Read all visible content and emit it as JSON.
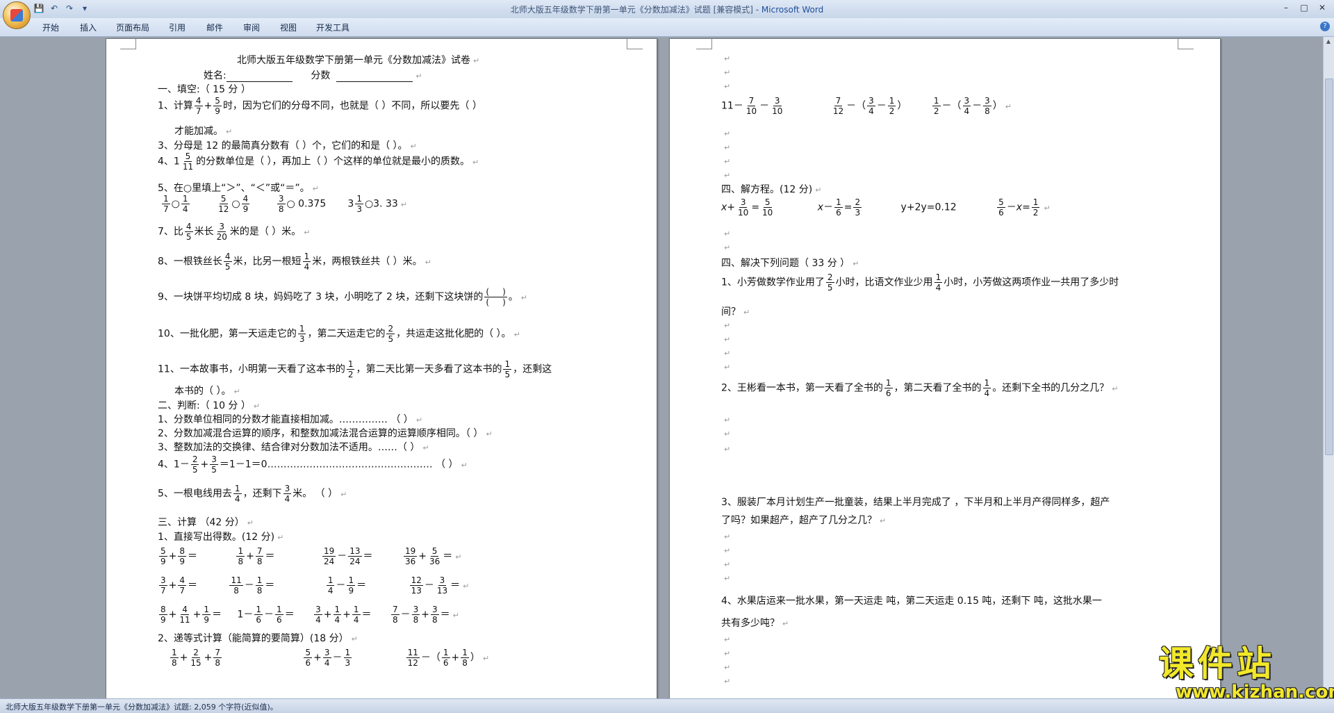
{
  "window": {
    "title": "北师大版五年级数学下册第一单元《分数加减法》试题 [兼容模式] - ",
    "app": "Microsoft Word"
  },
  "ribbon_tabs": [
    "开始",
    "插入",
    "页面布局",
    "引用",
    "邮件",
    "审阅",
    "视图",
    "开发工具"
  ],
  "status": "北师大版五年级数学下册第一单元《分数加减法》试题: 2,059 个字符(近似值)。",
  "watermark": {
    "brand": "课件站",
    "url": "www.kjzhan.com"
  },
  "p1": {
    "title": "北师大版五年级数学下册第一单元《分数加减法》试卷",
    "name_label": "姓名:",
    "score_label": "分数",
    "s1": "一、填空:（ 15 分 ）",
    "q1a": "1、计算",
    "q1b": "时，因为它们的分母不同，也就是（        ）不同，所以要先（            ）",
    "q1c": "才能加减。",
    "q3": "3、分母是 12 的最简真分数有（        ）个，它们的和是（        ）。",
    "q4a": "4、1",
    "q4b": "的分数单位是（        ），再加上（        ）个这样的单位就是最小的质数。",
    "q5": "5、在○里填上“＞”、“＜”或“＝”。",
    "q5d": "○ 0.375",
    "q5e": "○3. 33",
    "q7a": "7、比",
    "q7b": "米长",
    "q7c": "米的是（        ）米。",
    "q8a": "8、一根铁丝长",
    "q8b": "米，比另一根短",
    "q8c": "米，两根铁丝共（        ）米。",
    "q9": "9、一块饼平均切成 8 块，妈妈吃了 3 块，小明吃了 2 块，还剩下这块饼的",
    "q10a": "10、一批化肥，第一天运走它的",
    "q10b": "，第二天运走它的",
    "q10c": "，共运走这批化肥的（        ）。",
    "q11a": "11、一本故事书，小明第一天看了这本书的",
    "q11b": "，第二天比第一天多看了这本书的",
    "q11c": "，还剩这",
    "q11d": "本书的（        ）。",
    "s2": "二、判断:（ 10 分 ）",
    "j1": "1、分数单位相同的分数才能直接相加减。……………      （      ）",
    "j2": "2、分数加减混合运算的顺序，和整数加减法混合运算的运算顺序相同。（      ）",
    "j3": "3、整数加法的交换律、结合律对分数加法不适用。……（      ）",
    "j4a": "4、1－",
    "j4b": "＝1－1＝0…………………………………………… （      ）",
    "j5a": "5、一根电线用去",
    "j5b": "，还剩下",
    "j5c": "米。                              （      ）",
    "s3": "三、计算 （42 分）",
    "c1": "1、直接写出得数。(12 分)",
    "c2": "2、递等式计算（能简算的要简算）(18 分）"
  },
  "p2": {
    "s4a": "四、解方程。(12 分)",
    "eq3": "y+2y=0.12",
    "s4b": "四、解决下列问题（ 33 分 ）",
    "w1a": "1、小芳做数学作业用了",
    "w1b": "小时，比语文作业少用",
    "w1c": "小时，小芳做这两项作业一共用了多少时",
    "w1d": "间？",
    "w2a": "2、王彬看一本书，第一天看了全书的",
    "w2b": "，第二天看了全书的",
    "w2c": "。还剩下全书的几分之几？",
    "w3a": "3、服装厂本月计划生产一批童装，结果上半月完成了    ，下半月和上半月产得同样多，超产",
    "w3b": "了吗？如果超产，超产了几分之几？",
    "w4a": "4、水果店运来一批水果，第一天运走    吨，第二天运走 0.15 吨，还剩下    吨，这批水果一",
    "w4b": "共有多少吨？"
  }
}
